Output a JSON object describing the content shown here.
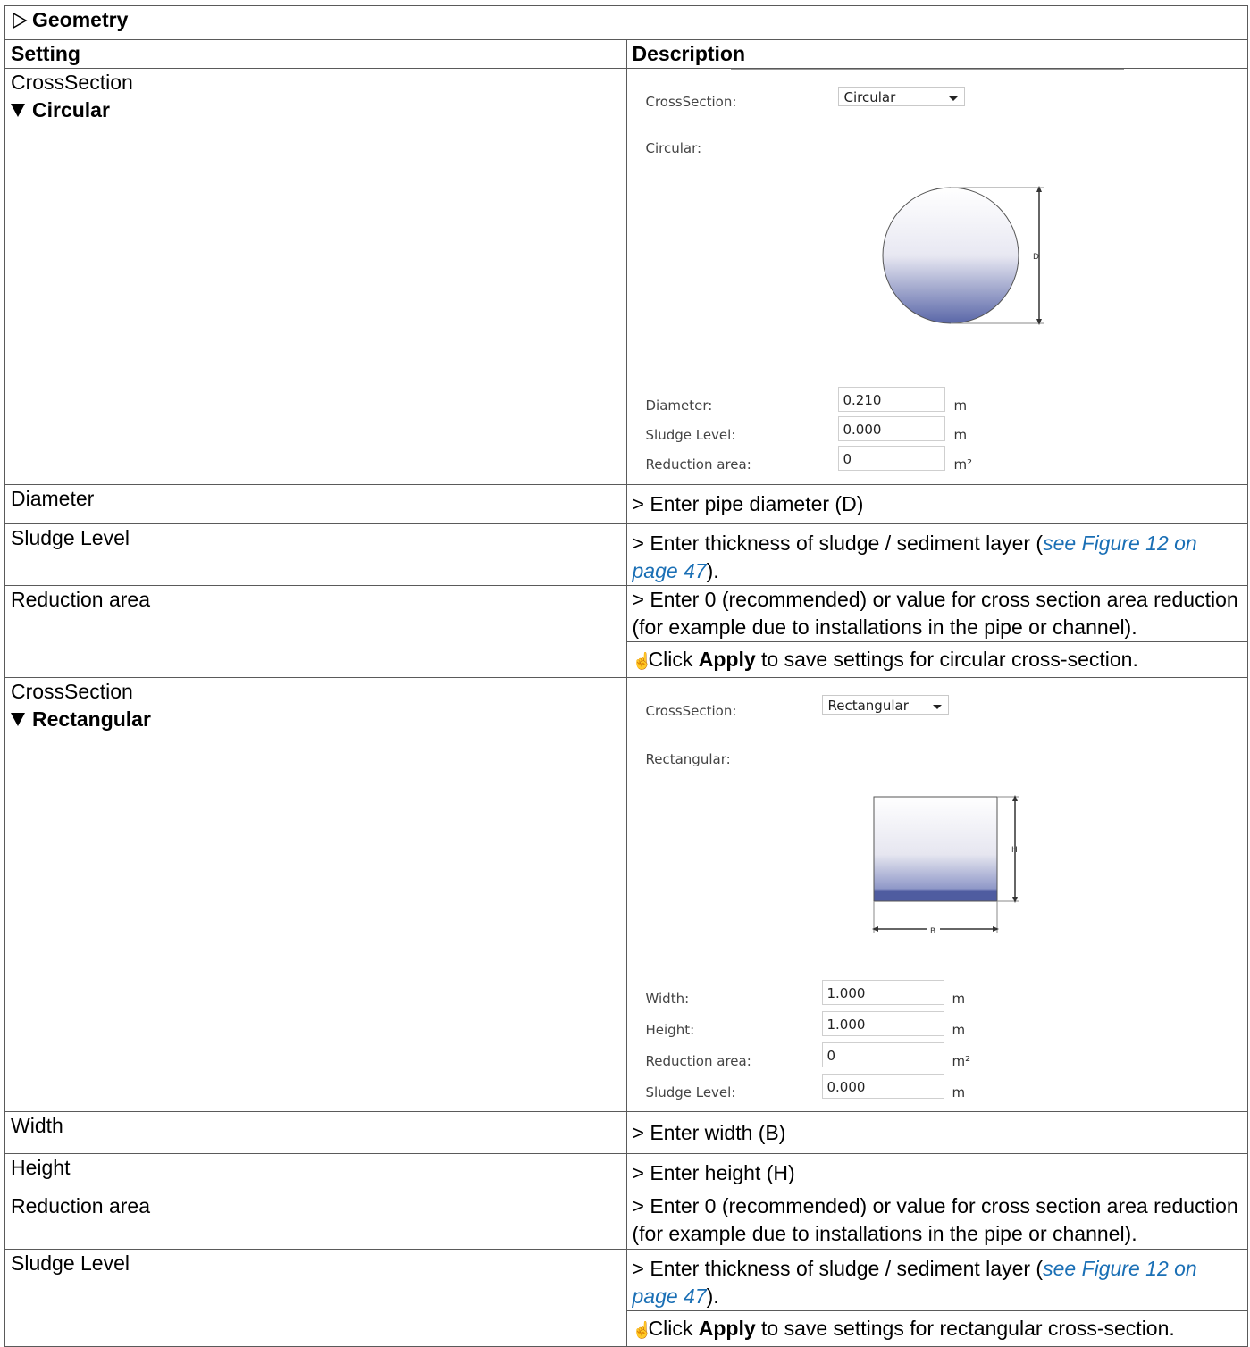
{
  "section": {
    "title": "Geometry"
  },
  "header": {
    "setting": "Setting",
    "description": "Description"
  },
  "circular": {
    "setting_label": "CrossSection",
    "setting_value": "Circular",
    "panel": {
      "cross_section_label": "CrossSection:",
      "cross_section_value": "Circular",
      "shape_title": "Circular:",
      "dimension_label": "D",
      "fields": [
        {
          "label": "Diameter:",
          "value": "0.210",
          "unit": "m"
        },
        {
          "label": "Sludge Level:",
          "value": "0.000",
          "unit": "m"
        },
        {
          "label": "Reduction area:",
          "value": "0",
          "unit": "m²"
        }
      ]
    },
    "rows": [
      {
        "setting": "Diameter",
        "desc": "> Enter pipe diameter (D)"
      },
      {
        "setting": "Sludge Level",
        "desc_before": "> Enter thickness of sludge / sediment layer (",
        "link": "see Figure 12 on page 47",
        "desc_after": ")."
      },
      {
        "setting": "Reduction area",
        "desc": "> Enter 0 (recommended) or value for cross section area reduction (for example due to installations in the pipe or channel)."
      }
    ],
    "apply": {
      "before": "Click ",
      "bold": "Apply",
      "after": " to save settings for circular cross-section."
    }
  },
  "rectangular": {
    "setting_label": "CrossSection",
    "setting_value": "Rectangular",
    "panel": {
      "cross_section_label": "CrossSection:",
      "cross_section_value": "Rectangular",
      "shape_title": "Rectangular:",
      "height_label": "H",
      "width_label": "B",
      "fields": [
        {
          "label": "Width:",
          "value": "1.000",
          "unit": "m"
        },
        {
          "label": "Height:",
          "value": "1.000",
          "unit": "m"
        },
        {
          "label": "Reduction area:",
          "value": "0",
          "unit": "m²"
        },
        {
          "label": "Sludge Level:",
          "value": "0.000",
          "unit": "m"
        }
      ]
    },
    "rows": [
      {
        "setting": "Width",
        "desc": "> Enter width (B)"
      },
      {
        "setting": "Height",
        "desc": "> Enter height (H)"
      },
      {
        "setting": "Reduction area",
        "desc": "> Enter 0 (recommended) or value for cross section area reduction (for example due to installations in the pipe or channel)."
      },
      {
        "setting": "Sludge Level",
        "desc_before": "> Enter thickness of sludge / sediment layer (",
        "link": "see Figure 12 on page 47",
        "desc_after": ")."
      }
    ],
    "apply": {
      "before": "Click ",
      "bold": "Apply",
      "after": " to save settings for rectangular cross-section."
    }
  }
}
